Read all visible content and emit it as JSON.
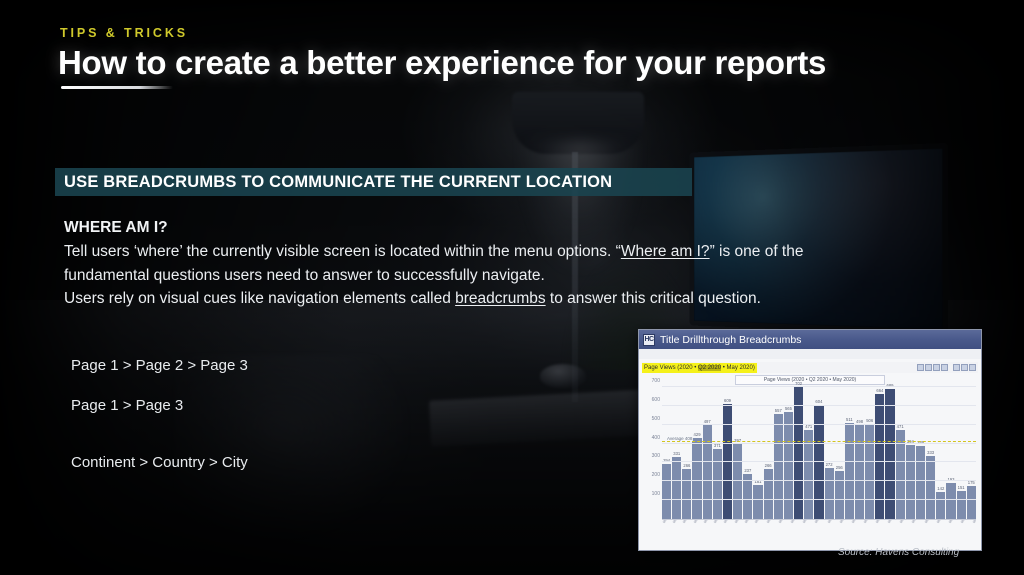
{
  "header": {
    "eyebrow": "TIPS & TRICKS",
    "title": "How to create a better experience for your reports"
  },
  "banner": {
    "label": "USE BREADCRUMBS TO COMMUNICATE THE CURRENT LOCATION",
    "color": "#1a4450"
  },
  "content": {
    "subhead": "WHERE AM I?",
    "paragraph_parts": {
      "p1a": "Tell users ‘where’ the currently visible screen is located within the menu options. “",
      "p1b": "Where am I?",
      "p1c": "” is one of the fundamental questions users need to answer to successfully navigate.",
      "p2a": "Users rely on visual cues like navigation elements called ",
      "p2b": "breadcrumbs",
      "p2c": " to answer this critical question."
    },
    "breadcrumb_examples": [
      "Page 1 > Page 2 > Page 3",
      "Page 1 > Page 3",
      "Continent > Country > City"
    ]
  },
  "report_window": {
    "app_icon_label": "HC",
    "title": "Title Drillthrough Breadcrumbs",
    "breadcrumb": {
      "prefix": "Page Views (2020 • ",
      "selected": "Q2 2020",
      "suffix": " • May 2020)"
    },
    "toolbar_icons": [
      "filter-icon",
      "export-icon",
      "focus-icon",
      "more-icon",
      "back-icon",
      "reset-icon",
      "refresh-icon"
    ]
  },
  "chart_data": {
    "type": "bar",
    "title": "Page Views (2020 • Q2 2020 • May 2020)",
    "xlabel": "",
    "ylabel": "",
    "ylim": [
      0,
      700
    ],
    "yticks": [
      100,
      200,
      300,
      400,
      500,
      600,
      700
    ],
    "grid": true,
    "legend": "none",
    "average_label": "Average 408",
    "average_value": 408,
    "categories": [
      "May 1",
      "May 2",
      "May 3",
      "May 4",
      "May 5",
      "May 6",
      "May 7",
      "May 8",
      "May 9",
      "May 10",
      "May 11",
      "May 12",
      "May 13",
      "May 14",
      "May 15",
      "May 16",
      "May 17",
      "May 18",
      "May 19",
      "May 20",
      "May 21",
      "May 22",
      "May 23",
      "May 24",
      "May 25",
      "May 26",
      "May 27",
      "May 28",
      "May 29",
      "May 30",
      "May 31"
    ],
    "values": [
      294,
      331,
      266,
      429,
      497,
      371,
      609,
      397,
      237,
      181,
      266,
      557,
      565,
      702,
      471,
      604,
      272,
      256,
      511,
      498,
      506,
      664,
      689,
      471,
      394,
      389,
      333,
      142,
      193,
      151,
      175
    ],
    "highlighted_indices": [
      6,
      13,
      15,
      21,
      22
    ],
    "bar_color": "#7d8cad",
    "highlight_color": "#3e4d74"
  },
  "footer": {
    "source": "Source: Havens Consulting"
  }
}
